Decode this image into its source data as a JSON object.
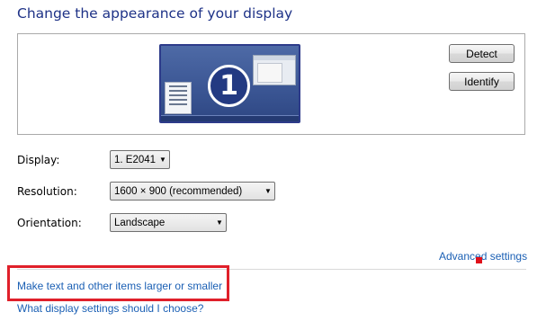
{
  "page": {
    "title": "Change the appearance of your display"
  },
  "preview": {
    "monitor_number": "1",
    "detect_label": "Detect",
    "identify_label": "Identify"
  },
  "settings": {
    "display_label": "Display:",
    "display_value": "1. E2041",
    "resolution_label": "Resolution:",
    "resolution_value": "1600 × 900 (recommended)",
    "orientation_label": "Orientation:",
    "orientation_value": "Landscape"
  },
  "links": {
    "advanced_settings": "Advanced settings",
    "text_size": "Make text and other items larger or smaller",
    "help": "What display settings should I choose?"
  },
  "colors": {
    "title": "#1e3287",
    "link": "#1a5fb4",
    "highlight": "#e0202a"
  },
  "icons": {
    "dropdown": "chevron-down-icon"
  }
}
